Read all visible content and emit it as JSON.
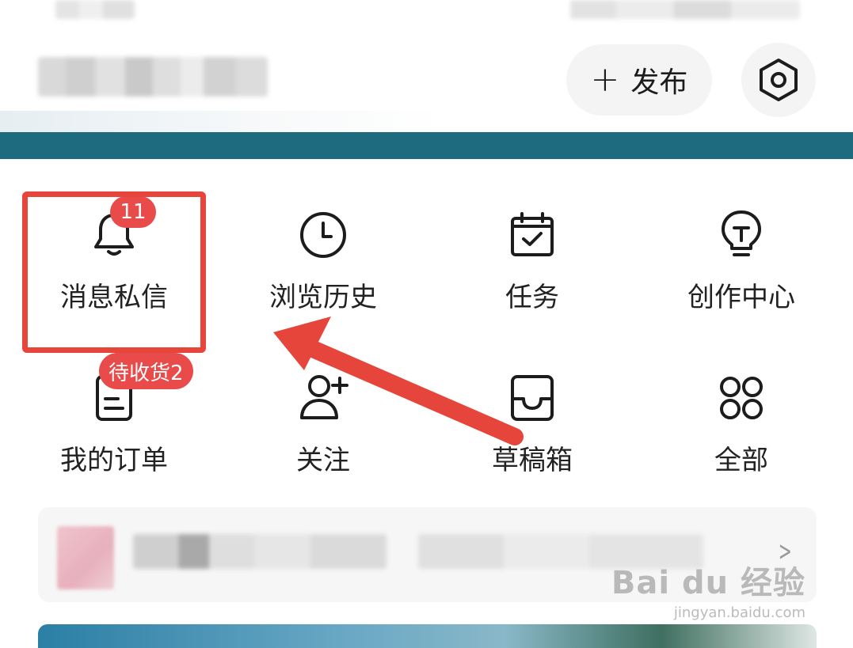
{
  "header": {
    "publish_label": "发布"
  },
  "shortcuts": [
    {
      "label": "消息私信",
      "badge": "11"
    },
    {
      "label": "浏览历史"
    },
    {
      "label": "任务"
    },
    {
      "label": "创作中心"
    },
    {
      "label": "我的订单",
      "badge": "待收货2"
    },
    {
      "label": "关注"
    },
    {
      "label": "草稿箱"
    },
    {
      "label": "全部"
    }
  ],
  "watermark": {
    "main": "Bai du 经验",
    "sub": "jingyan.baidu.com"
  },
  "colors": {
    "badge": "#e94b4b",
    "highlight": "#e5453a",
    "teal_band": "#1e6a7f"
  }
}
